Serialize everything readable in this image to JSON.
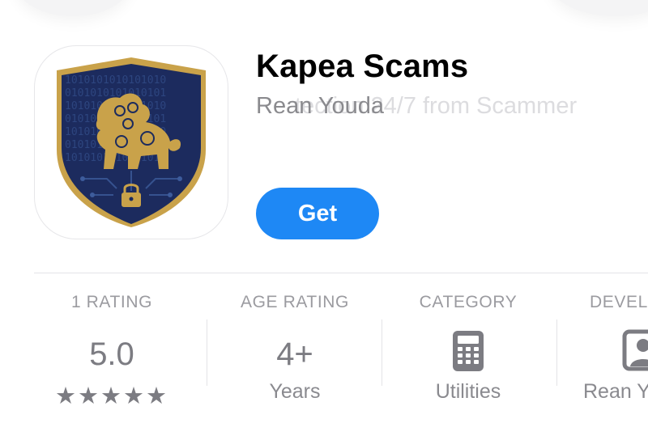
{
  "app": {
    "title": "Kapea Scams",
    "developer": "Rean Youda",
    "subtitle_ghost": "tection 24/7 from Scammer",
    "get_label": "Get"
  },
  "info": {
    "rating": {
      "label": "1 RATING",
      "value": "5.0",
      "stars": "★★★★★",
      "star_count": 5
    },
    "age": {
      "label": "AGE RATING",
      "value": "4+",
      "sub": "Years"
    },
    "category": {
      "label": "CATEGORY",
      "icon": "calculator-icon",
      "sub": "Utilities"
    },
    "developer": {
      "label": "DEVEL",
      "icon": "person-icon",
      "sub": "Rean Y"
    }
  },
  "colors": {
    "get_button": "#1e88f5",
    "shield_navy": "#1c2b5e",
    "shield_gold": "#c9a24a"
  }
}
